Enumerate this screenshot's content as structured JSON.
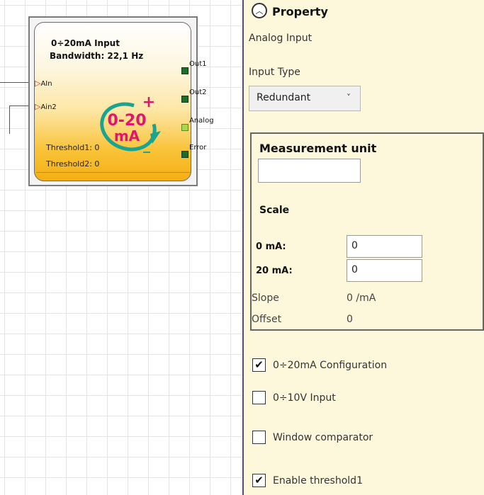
{
  "block": {
    "title": "0÷20mA Input",
    "bandwidth": "Bandwidth: 22,1 Hz",
    "logo_line1": "0-20",
    "logo_line2": "mA",
    "logo_plus": "+",
    "logo_minus": "_",
    "inputs": [
      "AIn",
      "Ain2"
    ],
    "outputs": [
      "Out1",
      "Out2",
      "Analog",
      "Error"
    ],
    "threshold1": "Threshold1: 0",
    "threshold2": "Threshold2: 0"
  },
  "panel": {
    "title": "Property",
    "subtitle": "Analog Input",
    "input_type_label": "Input Type",
    "input_type_value": "Redundant",
    "measurement_unit_label": "Measurement unit",
    "measurement_unit_value": "",
    "scale_label": "Scale",
    "ma0_label": "0 mA:",
    "ma0_value": "0",
    "ma20_label": "20 mA:",
    "ma20_value": "0",
    "slope_label": "Slope",
    "slope_value": "0 /mA",
    "offset_label": "Offset",
    "offset_value": "0"
  },
  "checkboxes": [
    {
      "label": "0÷20mA Configuration",
      "checked": true
    },
    {
      "label": "0÷10V Input",
      "checked": false
    },
    {
      "label": "Window comparator",
      "checked": false
    },
    {
      "label": "Enable threshold1",
      "checked": true
    }
  ],
  "colors": {
    "logo_text": "#e0156f",
    "logo_arrow": "#1aa38f",
    "panel_bg": "#fdf8dc",
    "out_pin": "#1c6d2c",
    "analog_pin": "#a8d84a"
  }
}
